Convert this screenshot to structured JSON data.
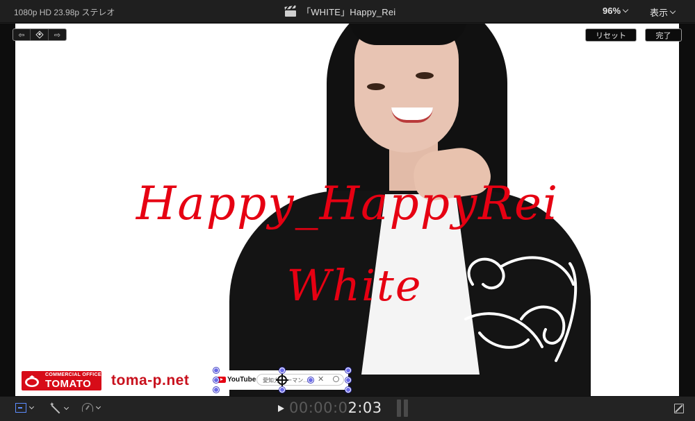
{
  "topbar": {
    "format_info": "1080p HD 23.98p ステレオ",
    "project_title": "「WHITE」Happy_Rei",
    "zoom": "96%",
    "view_menu": "表示"
  },
  "viewer": {
    "reset_label": "リセット",
    "done_label": "完了",
    "title_line1": "Happy_HappyRei",
    "title_line2": "White",
    "logo_small": "COMMERCIAL OFFICE",
    "logo_big": "TOMATO",
    "site_url": "toma-p.net",
    "youtube_label": "YouTube",
    "search_text": "愛知力… ーマン…"
  },
  "transport": {
    "timecode_dim": "00:00:0",
    "timecode_bright": "2:03"
  },
  "colors": {
    "title_red": "#e60012",
    "brand_red": "#d70c18",
    "accent_blue": "#5d8dff"
  }
}
